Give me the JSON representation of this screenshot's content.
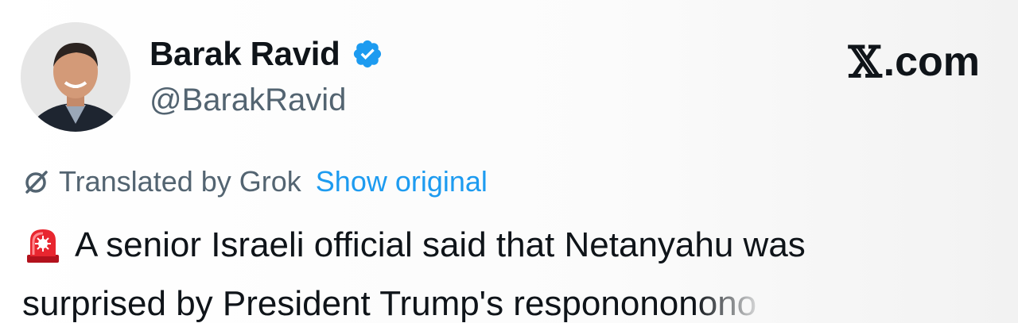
{
  "author": {
    "display_name": "Barak Ravid",
    "handle": "@BarakRavid",
    "verified": true
  },
  "brand": {
    "label": ".com",
    "logo": "x-logo-icon"
  },
  "translation": {
    "label": "Translated by Grok",
    "action": "Show original",
    "icon": "translate-icon"
  },
  "tweet": {
    "emoji": "rotating-light-icon",
    "line1": "A senior Israeli official said that Netanyahu was",
    "line2_visible": "surprised by President Trump's respon",
    "line2_faded": "ononono"
  },
  "colors": {
    "text": "#0f1419",
    "secondary": "#536471",
    "accent": "#1d9bf0"
  }
}
